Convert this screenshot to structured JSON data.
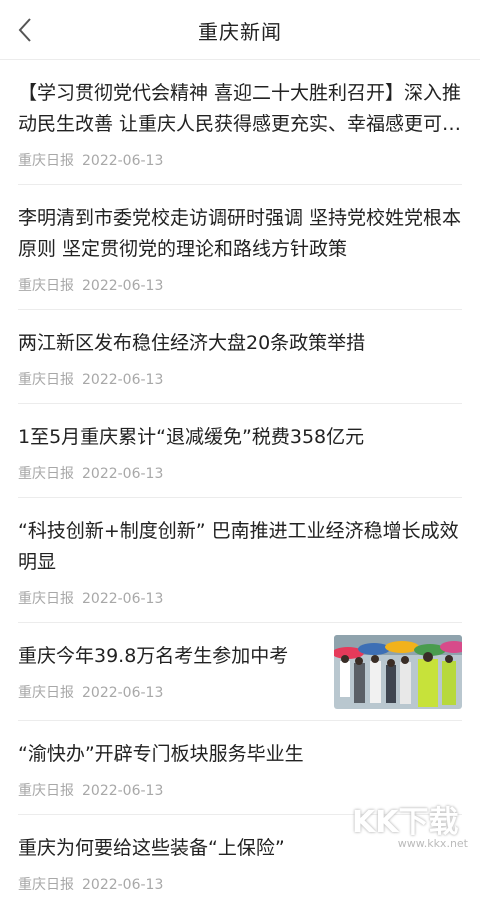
{
  "header": {
    "title": "重庆新闻",
    "back_icon": "chevron-left-icon"
  },
  "articles": [
    {
      "title": "【学习贯彻党代会精神 喜迎二十大胜利召开】深入推动民生改善 让重庆人民获得感更充实、幸福感更可持续",
      "source": "重庆日报",
      "date": "2022-06-13"
    },
    {
      "title": "李明清到市委党校走访调研时强调 坚持党校姓党根本原则 坚定贯彻党的理论和路线方针政策",
      "source": "重庆日报",
      "date": "2022-06-13"
    },
    {
      "title": "两江新区发布稳住经济大盘20条政策举措",
      "source": "重庆日报",
      "date": "2022-06-13"
    },
    {
      "title": "1至5月重庆累计“退减缓免”税费358亿元",
      "source": "重庆日报",
      "date": "2022-06-13"
    },
    {
      "title": "“科技创新+制度创新” 巴南推进工业经济稳增长成效明显",
      "source": "重庆日报",
      "date": "2022-06-13"
    },
    {
      "title": "重庆今年39.8万名考生参加中考",
      "source": "重庆日报",
      "date": "2022-06-13",
      "thumbnail": "umbrella-crowd-photo"
    },
    {
      "title": "“渝快办”开辟专门板块服务毕业生",
      "source": "重庆日报",
      "date": "2022-06-13"
    },
    {
      "title": "重庆为何要给这些装备“上保险”",
      "source": "重庆日报",
      "date": "2022-06-13"
    }
  ],
  "watermark": {
    "logo": "KK下载",
    "url": "www.kkx.net"
  }
}
